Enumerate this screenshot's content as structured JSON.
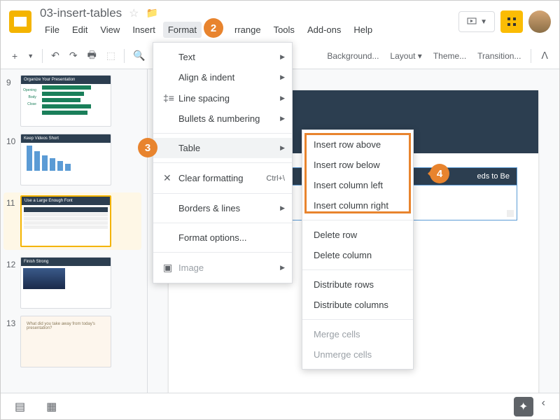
{
  "doc_title": "03-insert-tables",
  "menu": [
    "File",
    "Edit",
    "View",
    "Insert",
    "Format",
    "",
    "rrange",
    "Tools",
    "Add-ons",
    "Help"
  ],
  "toolbar_right": {
    "background": "Background...",
    "layout": "Layout",
    "theme": "Theme...",
    "transition": "Transition..."
  },
  "slides": [
    {
      "num": "9",
      "title": "Organize Your Presentation",
      "labels": [
        "Opening",
        "Body",
        "Close"
      ]
    },
    {
      "num": "10",
      "title": "Keep Videos Short"
    },
    {
      "num": "11",
      "title": "Use a Large Enough Font"
    },
    {
      "num": "12",
      "title": "Finish Strong"
    },
    {
      "num": "13",
      "text": "What did you take away from today's presentation?"
    }
  ],
  "canvas": {
    "header_text": "eds to Be"
  },
  "format_menu": {
    "text": "Text",
    "align": "Align & indent",
    "line_spacing": "Line spacing",
    "bullets": "Bullets & numbering",
    "table": "Table",
    "clear": "Clear formatting",
    "clear_short": "Ctrl+\\",
    "borders": "Borders & lines",
    "options": "Format options...",
    "image": "Image"
  },
  "table_submenu": {
    "row_above": "Insert row above",
    "row_below": "Insert row below",
    "col_left": "Insert column left",
    "col_right": "Insert column right",
    "del_row": "Delete row",
    "del_col": "Delete column",
    "dist_rows": "Distribute rows",
    "dist_cols": "Distribute columns",
    "merge": "Merge cells",
    "unmerge": "Unmerge cells"
  },
  "badges": {
    "b2": "2",
    "b3": "3",
    "b4": "4"
  }
}
